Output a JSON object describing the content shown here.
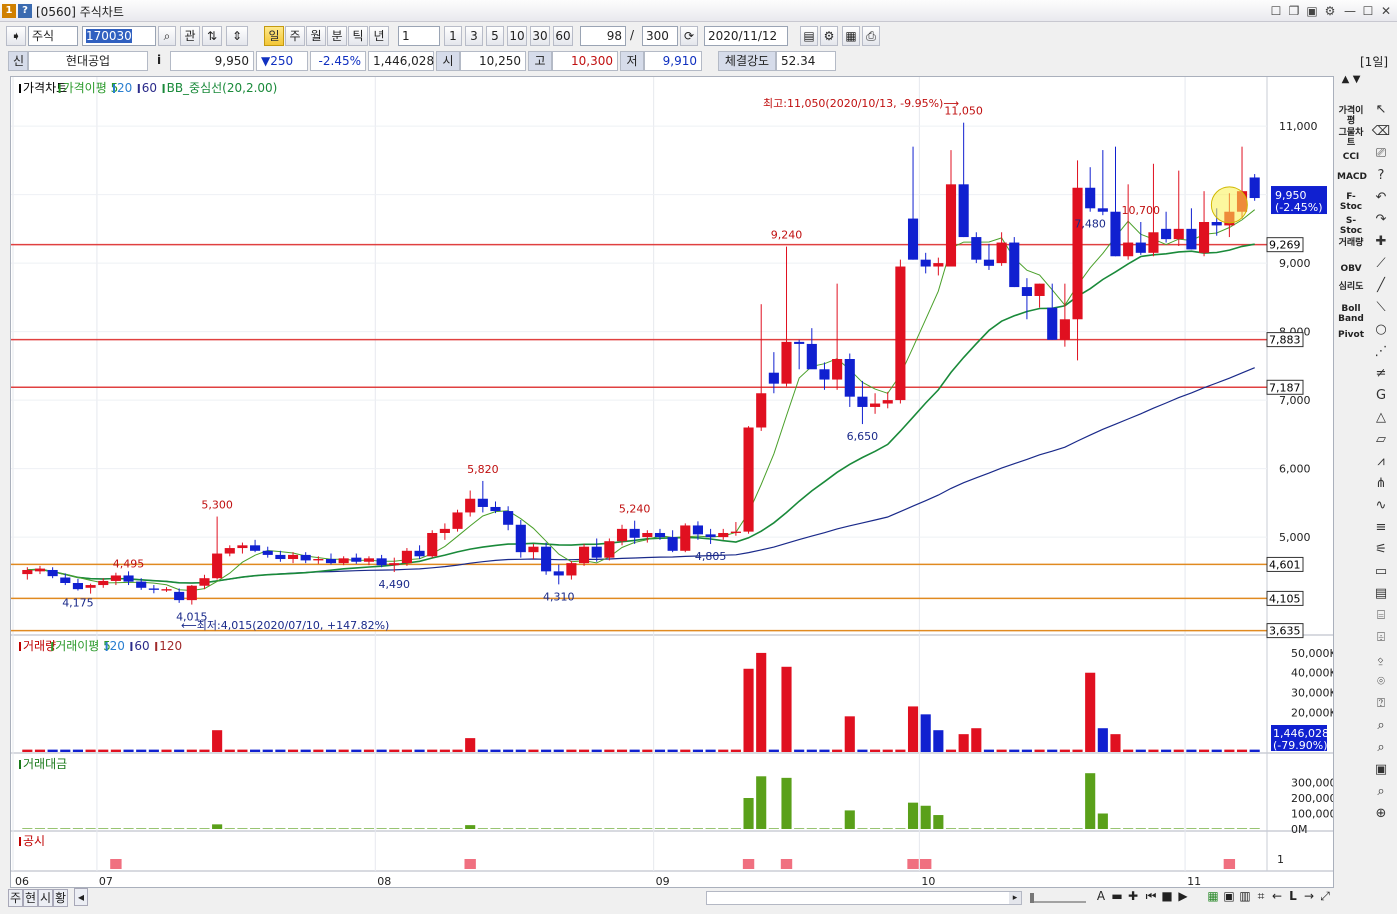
{
  "window": {
    "badge1": "1",
    "badge2": "?",
    "title": "[0560] 주식차트"
  },
  "toolbar": {
    "market": "주식",
    "code": "170030",
    "manage_label": "관",
    "periods": [
      "일",
      "주",
      "월",
      "분",
      "틱",
      "년"
    ],
    "active_period": "일",
    "interval_value": "1",
    "interval_buttons": [
      "1",
      "3",
      "5",
      "10",
      "30",
      "60"
    ],
    "display_count": "98",
    "total_count": "300",
    "slash": "/",
    "date": "2020/11/12"
  },
  "quote": {
    "credit_label": "신",
    "name": "현대공업",
    "info_icon": "i",
    "price": "9,950",
    "change": "▼250",
    "change_pct": "-2.45%",
    "volume": "1,446,028",
    "open_label": "시",
    "open": "10,250",
    "high_label": "고",
    "high": "10,300",
    "low_label": "저",
    "low": "9,910",
    "strength_label": "체결강도",
    "strength": "52.34",
    "period_tag": "[1일]"
  },
  "panes": {
    "price": {
      "legend": [
        {
          "text": "가격차트",
          "color": "#000000"
        },
        {
          "text": "가격이평 5",
          "color": "#2a9a2a"
        },
        {
          "text": "20",
          "color": "#2a7fd0"
        },
        {
          "text": "60",
          "color": "#2a2a8a"
        },
        {
          "text": "BB_중심선(20,2.00)",
          "color": "#1a8a3a"
        }
      ],
      "high_note": "최고:11,050(2020/10/13, -9.95%)⟶",
      "low_note": "⟵최저:4,015(2020/07/10, +147.82%)"
    },
    "volume": {
      "legend": [
        {
          "text": "거래량",
          "color": "#c00000"
        },
        {
          "text": "거래이평 5",
          "color": "#2a9a2a"
        },
        {
          "text": "20",
          "color": "#2a7fd0"
        },
        {
          "text": "60",
          "color": "#2a2a8a"
        },
        {
          "text": "120",
          "color": "#a02a2a"
        }
      ],
      "current": "1,446,028",
      "current_pct": "(-79.90%)"
    },
    "amount": {
      "legend": [
        {
          "text": "거래대금",
          "color": "#1a7a1a"
        }
      ]
    },
    "disclosure": {
      "legend": [
        {
          "text": "공시",
          "color": "#c00000"
        }
      ],
      "axis_label": "1"
    }
  },
  "bottom": {
    "tabs": [
      "주",
      "현",
      "시",
      "황"
    ],
    "tool_labels": [
      "A",
      "L"
    ]
  },
  "side_indicators": [
    "가격이평",
    "그물차트",
    "CCI",
    "MACD",
    "F-Stoc",
    "S-Stoc",
    "거래량",
    "OBV",
    "심리도",
    "Boll Band",
    "Pivot"
  ],
  "chart_data": [
    {
      "type": "candlestick",
      "title": "가격차트",
      "x_labels": [
        "06",
        "07",
        "08",
        "09",
        "10",
        "11"
      ],
      "ylim": [
        3600,
        11600
      ],
      "y_ticks": [
        "5,000",
        "6,000",
        "7,000",
        "8,000",
        "9,000",
        "10,000",
        "11,000"
      ],
      "candles": [
        [
          4460,
          4560,
          4380,
          4520
        ],
        [
          4500,
          4580,
          4460,
          4540
        ],
        [
          4520,
          4560,
          4400,
          4430
        ],
        [
          4410,
          4470,
          4300,
          4330
        ],
        [
          4330,
          4390,
          4220,
          4240
        ],
        [
          4260,
          4320,
          4175,
          4300
        ],
        [
          4300,
          4400,
          4260,
          4360
        ],
        [
          4360,
          4480,
          4300,
          4440
        ],
        [
          4440,
          4500,
          4300,
          4350
        ],
        [
          4350,
          4400,
          4230,
          4260
        ],
        [
          4250,
          4300,
          4180,
          4230
        ],
        [
          4220,
          4270,
          4200,
          4240
        ],
        [
          4200,
          4250,
          4040,
          4080
        ],
        [
          4080,
          4300,
          4015,
          4290
        ],
        [
          4290,
          4450,
          4240,
          4400
        ],
        [
          4400,
          5300,
          4380,
          4760
        ],
        [
          4760,
          4880,
          4720,
          4840
        ],
        [
          4840,
          4920,
          4760,
          4880
        ],
        [
          4880,
          4960,
          4780,
          4800
        ],
        [
          4800,
          4860,
          4700,
          4740
        ],
        [
          4740,
          4800,
          4640,
          4680
        ],
        [
          4680,
          4780,
          4620,
          4740
        ],
        [
          4740,
          4780,
          4620,
          4660
        ],
        [
          4660,
          4720,
          4610,
          4680
        ],
        [
          4680,
          4760,
          4600,
          4620
        ],
        [
          4620,
          4720,
          4590,
          4690
        ],
        [
          4700,
          4760,
          4610,
          4640
        ],
        [
          4640,
          4720,
          4590,
          4690
        ],
        [
          4690,
          4740,
          4560,
          4590
        ],
        [
          4590,
          4700,
          4490,
          4620
        ],
        [
          4620,
          4840,
          4580,
          4800
        ],
        [
          4800,
          4880,
          4680,
          4720
        ],
        [
          4720,
          5100,
          4700,
          5060
        ],
        [
          5060,
          5200,
          4960,
          5120
        ],
        [
          5120,
          5400,
          5080,
          5360
        ],
        [
          5360,
          5680,
          5300,
          5560
        ],
        [
          5560,
          5820,
          5360,
          5440
        ],
        [
          5440,
          5520,
          5350,
          5380
        ],
        [
          5380,
          5450,
          5100,
          5180
        ],
        [
          5180,
          5250,
          4700,
          4780
        ],
        [
          4780,
          4900,
          4680,
          4860
        ],
        [
          4860,
          4920,
          4450,
          4500
        ],
        [
          4500,
          4600,
          4310,
          4440
        ],
        [
          4440,
          4650,
          4380,
          4620
        ],
        [
          4620,
          4900,
          4580,
          4860
        ],
        [
          4860,
          4980,
          4640,
          4700
        ],
        [
          4700,
          4980,
          4660,
          4940
        ],
        [
          4940,
          5180,
          4880,
          5120
        ],
        [
          5120,
          5240,
          4900,
          4990
        ],
        [
          5000,
          5100,
          4920,
          5060
        ],
        [
          5060,
          5120,
          4960,
          5000
        ],
        [
          5000,
          5100,
          4780,
          4800
        ],
        [
          4800,
          5200,
          4780,
          5170
        ],
        [
          5170,
          5230,
          4960,
          5040
        ],
        [
          5040,
          5120,
          4900,
          5000
        ],
        [
          5000,
          5120,
          4960,
          5060
        ],
        [
          5060,
          5220,
          5020,
          5080
        ],
        [
          5080,
          6620,
          5050,
          6600
        ],
        [
          6600,
          8400,
          6550,
          7100
        ],
        [
          7400,
          7700,
          7100,
          7240
        ],
        [
          7240,
          9240,
          7200,
          7850
        ],
        [
          7850,
          7880,
          7450,
          7820
        ],
        [
          7820,
          8050,
          7480,
          7450
        ],
        [
          7450,
          7550,
          7150,
          7300
        ],
        [
          7300,
          8700,
          7150,
          7600
        ],
        [
          7600,
          7680,
          6900,
          7050
        ],
        [
          7050,
          7280,
          6650,
          6900
        ],
        [
          6900,
          7100,
          6800,
          6950
        ],
        [
          6950,
          7120,
          6880,
          7000
        ],
        [
          7000,
          9050,
          6950,
          8950
        ],
        [
          9650,
          10700,
          9050,
          9050
        ],
        [
          9050,
          9150,
          8850,
          8950
        ],
        [
          8950,
          9080,
          8820,
          9000
        ],
        [
          8950,
          10650,
          8950,
          10150
        ],
        [
          10150,
          11050,
          9380,
          9380
        ],
        [
          9380,
          9450,
          9000,
          9050
        ],
        [
          9050,
          9280,
          8900,
          8960
        ],
        [
          9000,
          9450,
          8960,
          9300
        ],
        [
          9300,
          9380,
          8650,
          8650
        ],
        [
          8650,
          8780,
          8180,
          8520
        ],
        [
          8520,
          8700,
          8350,
          8700
        ],
        [
          8350,
          8700,
          7880,
          7880
        ],
        [
          7880,
          8700,
          7780,
          8180
        ],
        [
          8180,
          10500,
          7580,
          10100
        ],
        [
          10100,
          10400,
          9750,
          9800
        ],
        [
          9800,
          10650,
          9700,
          9750
        ],
        [
          9750,
          10700,
          9100,
          9100
        ],
        [
          9100,
          10150,
          9050,
          9300
        ],
        [
          9300,
          9600,
          9120,
          9150
        ],
        [
          9150,
          10450,
          9100,
          9450
        ],
        [
          9500,
          9750,
          9300,
          9350
        ],
        [
          9350,
          10350,
          9250,
          9500
        ],
        [
          9500,
          9800,
          9200,
          9200
        ],
        [
          9150,
          10050,
          9100,
          9600
        ],
        [
          9600,
          9800,
          9400,
          9550
        ],
        [
          9550,
          10020,
          9380,
          9750
        ],
        [
          9750,
          10700,
          9650,
          10050
        ],
        [
          10250,
          10300,
          9910,
          9950
        ]
      ],
      "overlays": {
        "bb_mid_20": [
          4880,
          4860,
          4830,
          4800,
          4770,
          4740,
          4720,
          4700,
          4680,
          4660,
          4650,
          4620,
          4600,
          4580,
          4560,
          4540
        ],
        "support_lines": [
          {
            "value": 9269,
            "label": "9,269",
            "color": "#e04040"
          },
          {
            "value": 7883,
            "label": "7,883",
            "color": "#e04040"
          },
          {
            "value": 7187,
            "label": "7,187",
            "color": "#e04040"
          },
          {
            "value": 4601,
            "label": "4,601",
            "color": "#e08a20"
          },
          {
            "value": 4105,
            "label": "4,105",
            "color": "#e08a20"
          },
          {
            "value": 3635,
            "label": "3,635",
            "color": "#e08a20"
          }
        ],
        "price_tag": "9,950",
        "price_tag_pct": "(-2.45%)"
      },
      "peak_labels": [
        {
          "index": 15,
          "text": "5,300",
          "kind": "high"
        },
        {
          "index": 36,
          "text": "5,820",
          "kind": "high"
        },
        {
          "index": 48,
          "text": "5,240",
          "kind": "high"
        },
        {
          "index": 60,
          "text": "9,240",
          "kind": "high"
        },
        {
          "index": 74,
          "text": "11,050",
          "kind": "high"
        },
        {
          "index": 88,
          "text": "10,700",
          "kind": "high"
        },
        {
          "index": 4,
          "text": "4,175",
          "kind": "low"
        },
        {
          "index": 13,
          "text": "4,015",
          "kind": "low"
        },
        {
          "index": 29,
          "text": "4,490",
          "kind": "low"
        },
        {
          "index": 42,
          "text": "4,310",
          "kind": "low"
        },
        {
          "index": 54,
          "text": "4,805",
          "kind": "low"
        },
        {
          "index": 66,
          "text": "6,650",
          "kind": "low"
        },
        {
          "index": 84,
          "text": "7,480",
          "kind": "low"
        },
        {
          "index": 8,
          "text": "4,495",
          "kind": "mid"
        }
      ]
    },
    {
      "type": "bar",
      "title": "거래량",
      "ylim": [
        0,
        55000
      ],
      "y_ticks": [
        "20,000K",
        "30,000K",
        "40,000K",
        "50,000K"
      ],
      "spikes": [
        {
          "index": 15,
          "value": 11000,
          "color": "red"
        },
        {
          "index": 35,
          "value": 7000,
          "color": "red"
        },
        {
          "index": 57,
          "value": 42000,
          "color": "red"
        },
        {
          "index": 58,
          "value": 50000,
          "color": "red"
        },
        {
          "index": 60,
          "value": 43000,
          "color": "red"
        },
        {
          "index": 65,
          "value": 18000,
          "color": "red"
        },
        {
          "index": 70,
          "value": 23000,
          "color": "red"
        },
        {
          "index": 71,
          "value": 19000,
          "color": "blue"
        },
        {
          "index": 72,
          "value": 11000,
          "color": "blue"
        },
        {
          "index": 74,
          "value": 9000,
          "color": "red"
        },
        {
          "index": 75,
          "value": 12000,
          "color": "red"
        },
        {
          "index": 84,
          "value": 40000,
          "color": "red"
        },
        {
          "index": 85,
          "value": 12000,
          "color": "blue"
        },
        {
          "index": 86,
          "value": 9000,
          "color": "red"
        }
      ]
    },
    {
      "type": "bar",
      "title": "거래대금",
      "ylim": [
        0,
        400000
      ],
      "y_ticks": [
        "0M",
        "100,000M",
        "200,000M",
        "300,000M"
      ],
      "spikes": [
        {
          "index": 15,
          "value": 30000
        },
        {
          "index": 35,
          "value": 25000
        },
        {
          "index": 57,
          "value": 200000
        },
        {
          "index": 58,
          "value": 340000
        },
        {
          "index": 60,
          "value": 330000
        },
        {
          "index": 65,
          "value": 120000
        },
        {
          "index": 70,
          "value": 170000
        },
        {
          "index": 71,
          "value": 150000
        },
        {
          "index": 72,
          "value": 90000
        },
        {
          "index": 84,
          "value": 360000
        },
        {
          "index": 85,
          "value": 100000
        }
      ]
    },
    {
      "type": "bar",
      "title": "공시",
      "ticks": [
        7,
        35,
        57,
        60,
        70,
        71,
        95
      ]
    }
  ]
}
